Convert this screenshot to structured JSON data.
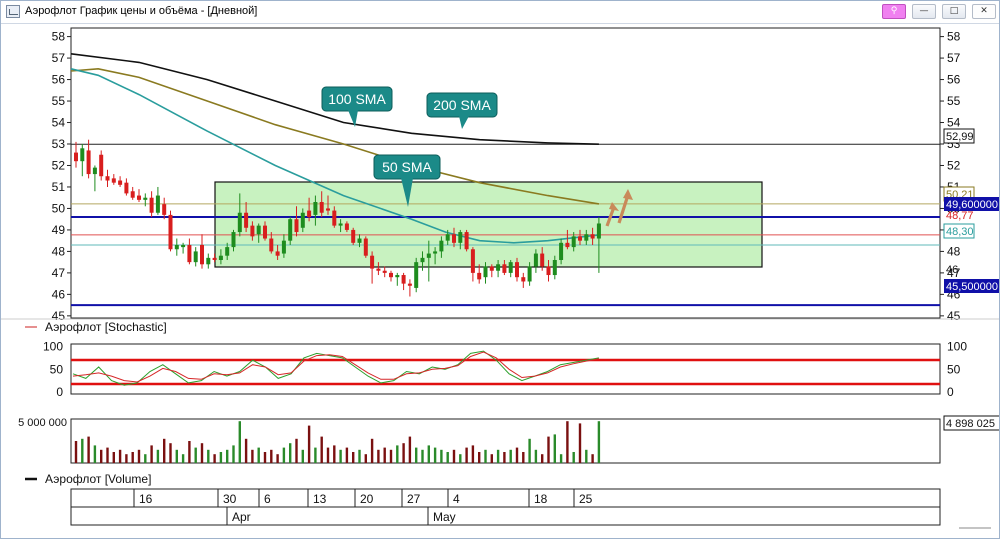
{
  "window": {
    "title": "Аэрофлот График цены и объёма - [Дневной]",
    "buttons": [
      "⚲",
      "—",
      "□",
      "✕"
    ]
  },
  "price_panel": {
    "y_ticks": [
      "58",
      "57",
      "56",
      "55",
      "54",
      "53",
      "52",
      "51",
      "50",
      "49",
      "48",
      "47",
      "46",
      "45"
    ],
    "price_tags": {
      "sma200_last": "52,99",
      "sma100_last": "50,21",
      "resistance": "49,600000",
      "sma50_last": "48,77",
      "mid_level": "48,30",
      "bottom_partial": "46",
      "support": "45,500000"
    },
    "callouts": {
      "sma100": "100 SMA",
      "sma200": "200 SMA",
      "sma50": "50 SMA"
    },
    "colors": {
      "up_candle": "#1e8c1e",
      "down_candle": "#d81e1e",
      "sma50": "#2a9d9d",
      "sma100": "#8a7a20",
      "sma200": "#111111",
      "zone_fill": "#c8f2c0",
      "level_line": "#1010a8",
      "callout_bg": "#1b8a88"
    }
  },
  "stoch_panel": {
    "legend": "Аэрофлот [Stochastic]",
    "y_ticks": [
      "100",
      "50",
      "0"
    ],
    "right_ticks": [
      "100",
      "50",
      "0"
    ],
    "levels": [
      80,
      20
    ]
  },
  "volume_panel": {
    "left_label": "5 000 000",
    "right_tag": "4 898 025",
    "legend": "Аэрофлот [Volume]"
  },
  "time_axis": {
    "days": [
      "16",
      "30",
      "6",
      "13",
      "20",
      "27",
      "4",
      "18",
      "25"
    ],
    "months": [
      "Apr",
      "May"
    ]
  },
  "chart_data": {
    "type": "candlestick",
    "candles": [
      {
        "o": 52.6,
        "h": 53.1,
        "l": 51.9,
        "c": 52.2
      },
      {
        "o": 52.2,
        "h": 53.0,
        "l": 51.5,
        "c": 52.8
      },
      {
        "o": 52.7,
        "h": 53.2,
        "l": 51.4,
        "c": 51.6
      },
      {
        "o": 51.6,
        "h": 52.0,
        "l": 50.8,
        "c": 51.9
      },
      {
        "o": 52.5,
        "h": 52.7,
        "l": 51.3,
        "c": 51.5
      },
      {
        "o": 51.5,
        "h": 51.8,
        "l": 51.0,
        "c": 51.3
      },
      {
        "o": 51.4,
        "h": 51.6,
        "l": 51.1,
        "c": 51.2
      },
      {
        "o": 51.3,
        "h": 51.5,
        "l": 51.0,
        "c": 51.1
      },
      {
        "o": 51.2,
        "h": 51.4,
        "l": 50.6,
        "c": 50.7
      },
      {
        "o": 50.8,
        "h": 51.0,
        "l": 50.4,
        "c": 50.5
      },
      {
        "o": 50.6,
        "h": 50.9,
        "l": 50.3,
        "c": 50.4
      },
      {
        "o": 50.4,
        "h": 50.7,
        "l": 50.1,
        "c": 50.5
      },
      {
        "o": 50.5,
        "h": 50.8,
        "l": 49.6,
        "c": 49.8
      },
      {
        "o": 49.8,
        "h": 51.0,
        "l": 49.7,
        "c": 50.6
      },
      {
        "o": 50.2,
        "h": 50.5,
        "l": 49.5,
        "c": 49.7
      },
      {
        "o": 49.7,
        "h": 49.9,
        "l": 48.0,
        "c": 48.1
      },
      {
        "o": 48.1,
        "h": 48.6,
        "l": 47.8,
        "c": 48.3
      },
      {
        "o": 48.2,
        "h": 48.4,
        "l": 47.9,
        "c": 48.3
      },
      {
        "o": 48.3,
        "h": 48.6,
        "l": 47.4,
        "c": 47.5
      },
      {
        "o": 47.5,
        "h": 48.2,
        "l": 47.3,
        "c": 48.0
      },
      {
        "o": 48.3,
        "h": 48.8,
        "l": 47.2,
        "c": 47.4
      },
      {
        "o": 47.4,
        "h": 47.9,
        "l": 47.2,
        "c": 47.7
      },
      {
        "o": 47.7,
        "h": 47.9,
        "l": 47.5,
        "c": 47.6
      },
      {
        "o": 47.6,
        "h": 48.1,
        "l": 47.4,
        "c": 47.8
      },
      {
        "o": 47.8,
        "h": 48.4,
        "l": 47.6,
        "c": 48.2
      },
      {
        "o": 48.2,
        "h": 49.0,
        "l": 48.0,
        "c": 48.9
      },
      {
        "o": 48.9,
        "h": 50.7,
        "l": 48.7,
        "c": 49.8
      },
      {
        "o": 49.8,
        "h": 50.3,
        "l": 48.9,
        "c": 49.1
      },
      {
        "o": 49.2,
        "h": 49.4,
        "l": 48.5,
        "c": 48.7
      },
      {
        "o": 48.8,
        "h": 49.3,
        "l": 48.4,
        "c": 49.2
      },
      {
        "o": 49.2,
        "h": 49.4,
        "l": 48.5,
        "c": 48.6
      },
      {
        "o": 48.6,
        "h": 48.9,
        "l": 47.9,
        "c": 48.0
      },
      {
        "o": 48.0,
        "h": 48.3,
        "l": 47.6,
        "c": 47.8
      },
      {
        "o": 47.9,
        "h": 48.8,
        "l": 47.7,
        "c": 48.5
      },
      {
        "o": 48.5,
        "h": 49.6,
        "l": 48.3,
        "c": 49.5
      },
      {
        "o": 49.5,
        "h": 50.1,
        "l": 48.7,
        "c": 48.9
      },
      {
        "o": 49.1,
        "h": 50.0,
        "l": 48.9,
        "c": 49.8
      },
      {
        "o": 49.9,
        "h": 50.5,
        "l": 49.4,
        "c": 49.6
      },
      {
        "o": 49.7,
        "h": 50.6,
        "l": 49.2,
        "c": 50.3
      },
      {
        "o": 50.3,
        "h": 50.8,
        "l": 49.6,
        "c": 49.8
      },
      {
        "o": 50.0,
        "h": 50.6,
        "l": 49.7,
        "c": 49.9
      },
      {
        "o": 49.9,
        "h": 50.1,
        "l": 49.1,
        "c": 49.2
      },
      {
        "o": 49.2,
        "h": 49.5,
        "l": 48.9,
        "c": 49.3
      },
      {
        "o": 49.3,
        "h": 49.4,
        "l": 48.9,
        "c": 49.0
      },
      {
        "o": 49.0,
        "h": 49.1,
        "l": 48.3,
        "c": 48.4
      },
      {
        "o": 48.4,
        "h": 48.8,
        "l": 48.2,
        "c": 48.6
      },
      {
        "o": 48.6,
        "h": 48.7,
        "l": 47.7,
        "c": 47.8
      },
      {
        "o": 47.8,
        "h": 48.0,
        "l": 46.5,
        "c": 47.2
      },
      {
        "o": 47.2,
        "h": 47.5,
        "l": 46.9,
        "c": 47.1
      },
      {
        "o": 47.1,
        "h": 47.3,
        "l": 46.8,
        "c": 47.0
      },
      {
        "o": 47.0,
        "h": 47.1,
        "l": 46.6,
        "c": 46.8
      },
      {
        "o": 46.8,
        "h": 47.0,
        "l": 46.4,
        "c": 46.9
      },
      {
        "o": 46.9,
        "h": 47.0,
        "l": 46.2,
        "c": 46.5
      },
      {
        "o": 46.5,
        "h": 46.7,
        "l": 45.9,
        "c": 46.4
      },
      {
        "o": 46.3,
        "h": 47.7,
        "l": 46.1,
        "c": 47.5
      },
      {
        "o": 47.5,
        "h": 48.0,
        "l": 47.1,
        "c": 47.7
      },
      {
        "o": 47.7,
        "h": 48.5,
        "l": 46.6,
        "c": 47.9
      },
      {
        "o": 47.9,
        "h": 48.2,
        "l": 47.4,
        "c": 48.0
      },
      {
        "o": 48.0,
        "h": 48.7,
        "l": 47.7,
        "c": 48.5
      },
      {
        "o": 48.5,
        "h": 49.0,
        "l": 48.3,
        "c": 48.8
      },
      {
        "o": 48.8,
        "h": 49.1,
        "l": 48.2,
        "c": 48.4
      },
      {
        "o": 48.4,
        "h": 49.0,
        "l": 48.1,
        "c": 48.9
      },
      {
        "o": 48.9,
        "h": 49.0,
        "l": 48.0,
        "c": 48.1
      },
      {
        "o": 48.1,
        "h": 48.2,
        "l": 46.6,
        "c": 47.0
      },
      {
        "o": 47.0,
        "h": 47.4,
        "l": 46.5,
        "c": 46.7
      },
      {
        "o": 46.8,
        "h": 47.5,
        "l": 46.5,
        "c": 47.3
      },
      {
        "o": 47.3,
        "h": 47.4,
        "l": 46.8,
        "c": 47.1
      },
      {
        "o": 47.1,
        "h": 47.6,
        "l": 46.8,
        "c": 47.4
      },
      {
        "o": 47.4,
        "h": 47.6,
        "l": 46.9,
        "c": 47.0
      },
      {
        "o": 47.0,
        "h": 47.6,
        "l": 46.8,
        "c": 47.5
      },
      {
        "o": 47.5,
        "h": 47.7,
        "l": 46.6,
        "c": 46.8
      },
      {
        "o": 46.8,
        "h": 47.0,
        "l": 46.3,
        "c": 46.6
      },
      {
        "o": 46.6,
        "h": 47.5,
        "l": 46.4,
        "c": 47.3
      },
      {
        "o": 47.3,
        "h": 48.1,
        "l": 47.0,
        "c": 47.9
      },
      {
        "o": 47.9,
        "h": 48.2,
        "l": 47.1,
        "c": 47.3
      },
      {
        "o": 47.3,
        "h": 47.6,
        "l": 46.6,
        "c": 46.9
      },
      {
        "o": 46.9,
        "h": 47.8,
        "l": 46.7,
        "c": 47.6
      },
      {
        "o": 47.6,
        "h": 48.6,
        "l": 47.4,
        "c": 48.4
      },
      {
        "o": 48.4,
        "h": 49.0,
        "l": 48.1,
        "c": 48.2
      },
      {
        "o": 48.2,
        "h": 48.9,
        "l": 48.0,
        "c": 48.7
      },
      {
        "o": 48.7,
        "h": 49.0,
        "l": 48.3,
        "c": 48.5
      },
      {
        "o": 48.5,
        "h": 49.0,
        "l": 48.3,
        "c": 48.8
      },
      {
        "o": 48.8,
        "h": 49.1,
        "l": 48.3,
        "c": 48.6
      },
      {
        "o": 48.6,
        "h": 49.6,
        "l": 47.0,
        "c": 49.3
      }
    ],
    "volume": [
      0.5,
      0.55,
      0.6,
      0.4,
      0.3,
      0.35,
      0.25,
      0.3,
      0.2,
      0.25,
      0.3,
      0.2,
      0.4,
      0.3,
      0.55,
      0.45,
      0.3,
      0.2,
      0.5,
      0.35,
      0.45,
      0.3,
      0.2,
      0.25,
      0.3,
      0.4,
      0.95,
      0.55,
      0.3,
      0.35,
      0.25,
      0.3,
      0.2,
      0.35,
      0.45,
      0.55,
      0.3,
      0.85,
      0.35,
      0.6,
      0.35,
      0.4,
      0.3,
      0.35,
      0.25,
      0.3,
      0.2,
      0.55,
      0.3,
      0.35,
      0.3,
      0.4,
      0.45,
      0.6,
      0.35,
      0.3,
      0.4,
      0.35,
      0.3,
      0.25,
      0.3,
      0.2,
      0.35,
      0.4,
      0.25,
      0.3,
      0.2,
      0.3,
      0.25,
      0.3,
      0.35,
      0.25,
      0.55,
      0.3,
      0.2,
      0.6,
      0.65,
      0.2,
      0.95,
      0.25,
      0.9,
      0.3,
      0.2,
      0.95
    ],
    "series": [
      {
        "name": "100 SMA",
        "x": [
          0,
          8,
          20,
          40,
          60,
          80,
          100,
          120,
          140,
          155
        ],
        "y": [
          56.4,
          56.5,
          56.1,
          55.0,
          53.9,
          53.0,
          52.0,
          51.2,
          50.6,
          50.21
        ]
      },
      {
        "name": "200 SMA",
        "x": [
          0,
          20,
          40,
          60,
          80,
          100,
          120,
          140,
          155
        ],
        "y": [
          57.2,
          56.8,
          56.0,
          55.0,
          54.0,
          53.5,
          53.2,
          53.05,
          52.99
        ]
      },
      {
        "name": "50 SMA",
        "x": [
          0,
          8,
          20,
          40,
          60,
          80,
          100,
          110,
          120,
          130,
          140,
          155
        ],
        "y": [
          56.5,
          56.2,
          55.3,
          53.6,
          52.0,
          50.6,
          49.5,
          48.9,
          48.5,
          48.4,
          48.5,
          48.77
        ]
      }
    ],
    "stochastic": {
      "k": [
        40,
        30,
        55,
        25,
        15,
        20,
        45,
        60,
        40,
        20,
        25,
        45,
        35,
        45,
        70,
        55,
        30,
        40,
        75,
        85,
        80,
        75,
        55,
        35,
        20,
        25,
        45,
        40,
        55,
        50,
        60,
        85,
        90,
        70,
        40,
        25,
        35,
        45,
        60,
        65,
        70,
        75
      ],
      "d": [
        35,
        38,
        42,
        35,
        25,
        22,
        35,
        52,
        45,
        30,
        28,
        40,
        38,
        42,
        60,
        55,
        38,
        42,
        68,
        80,
        82,
        78,
        60,
        42,
        28,
        28,
        40,
        42,
        50,
        52,
        58,
        78,
        88,
        75,
        50,
        32,
        35,
        42,
        55,
        62,
        68,
        73
      ]
    },
    "levels": {
      "resistance": 49.6,
      "support": 45.5,
      "sma200_line": 52.99,
      "mid_line": 48.3,
      "sma50_line": 48.77,
      "sma100_line": 50.21
    },
    "ylim": [
      44.9,
      58.4
    ]
  }
}
